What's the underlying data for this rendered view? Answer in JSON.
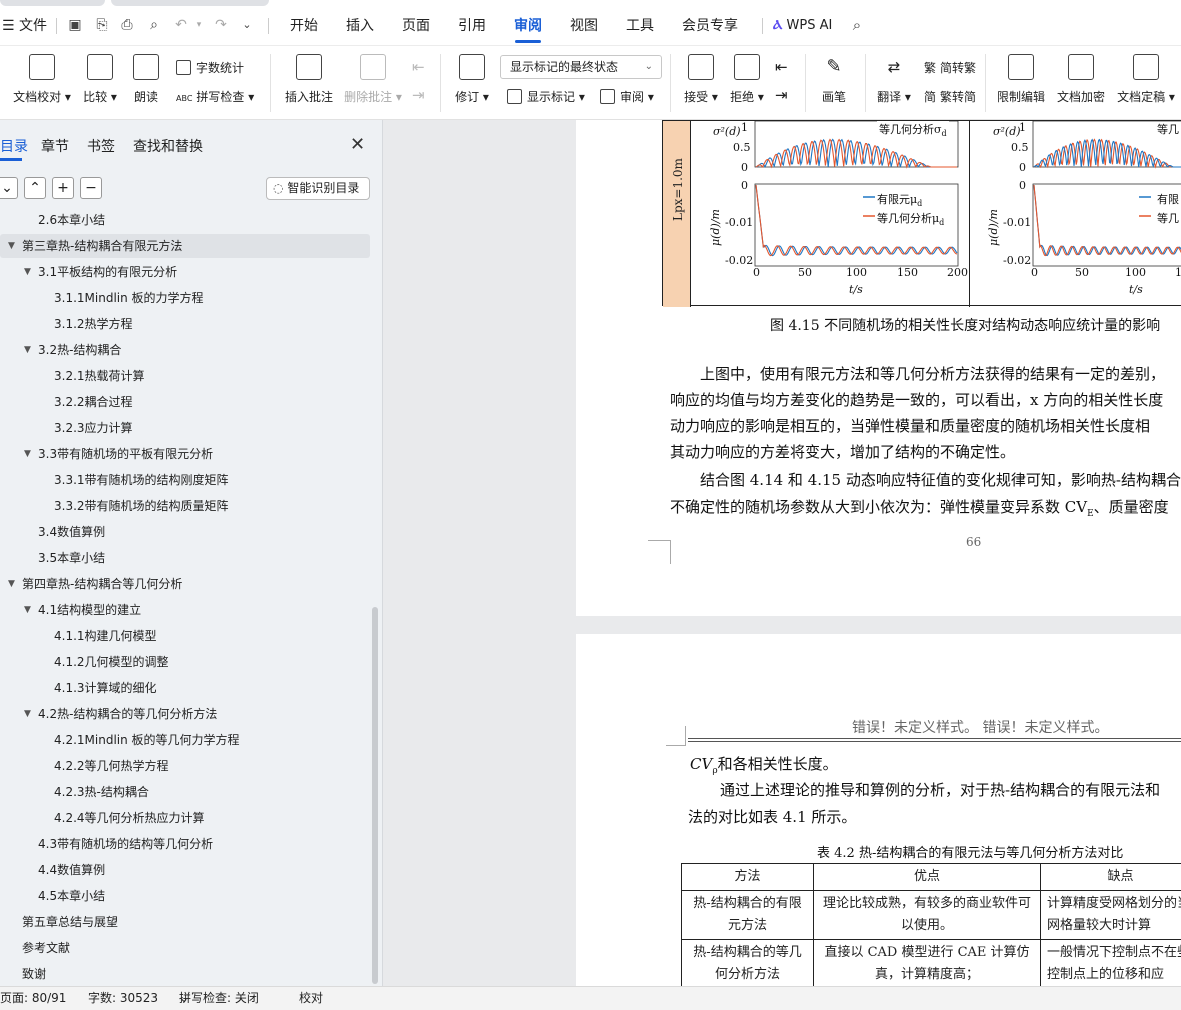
{
  "menubar": {
    "file_label": "文件",
    "items": [
      "开始",
      "插入",
      "页面",
      "引用",
      "审阅",
      "视图",
      "工具",
      "会员专享"
    ],
    "active": "审阅",
    "ai_label": "WPS AI"
  },
  "ribbon": {
    "doc_check": "文档校对",
    "compare": "比较",
    "read_aloud": "朗读",
    "word_count": "字数统计",
    "spell_check": "拼写检查",
    "insert_comment": "插入批注",
    "delete_comment": "删除批注",
    "revise": "修订",
    "markup_state": "显示标记的最终状态",
    "show_markup": "显示标记",
    "review": "审阅",
    "accept": "接受",
    "reject": "拒绝",
    "ink": "画笔",
    "translate": "翻译",
    "trad": "简转繁",
    "simp": "繁转简",
    "restrict_edit": "限制编辑",
    "encrypt": "文档加密",
    "finalize": "文档定稿"
  },
  "sidebar": {
    "tabs": [
      "目录",
      "章节",
      "书签",
      "查找和替换"
    ],
    "smart_toc": "智能识别目录",
    "toc": [
      {
        "text": "2.6本章小结",
        "level": 2,
        "arrow": false
      },
      {
        "text": "第三章热-结构耦合有限元方法",
        "level": 1,
        "arrow": true,
        "selected": true
      },
      {
        "text": "3.1平板结构的有限元分析",
        "level": 2,
        "arrow": true
      },
      {
        "text": "3.1.1Mindlin 板的力学方程",
        "level": 3,
        "arrow": false
      },
      {
        "text": "3.1.2热学方程",
        "level": 3,
        "arrow": false
      },
      {
        "text": "3.2热-结构耦合",
        "level": 2,
        "arrow": true
      },
      {
        "text": "3.2.1热载荷计算",
        "level": 3,
        "arrow": false
      },
      {
        "text": "3.2.2耦合过程",
        "level": 3,
        "arrow": false
      },
      {
        "text": "3.2.3应力计算",
        "level": 3,
        "arrow": false
      },
      {
        "text": "3.3带有随机场的平板有限元分析",
        "level": 2,
        "arrow": true
      },
      {
        "text": "3.3.1带有随机场的结构刚度矩阵",
        "level": 3,
        "arrow": false
      },
      {
        "text": "3.3.2带有随机场的结构质量矩阵",
        "level": 3,
        "arrow": false
      },
      {
        "text": "3.4数值算例",
        "level": 2,
        "arrow": false
      },
      {
        "text": "3.5本章小结",
        "level": 2,
        "arrow": false
      },
      {
        "text": "第四章热-结构耦合等几何分析",
        "level": 1,
        "arrow": true
      },
      {
        "text": "4.1结构模型的建立",
        "level": 2,
        "arrow": true
      },
      {
        "text": "4.1.1构建几何模型",
        "level": 3,
        "arrow": false
      },
      {
        "text": "4.1.2几何模型的调整",
        "level": 3,
        "arrow": false
      },
      {
        "text": "4.1.3计算域的细化",
        "level": 3,
        "arrow": false
      },
      {
        "text": "4.2热-结构耦合的等几何分析方法",
        "level": 2,
        "arrow": true
      },
      {
        "text": "4.2.1Mindlin 板的等几何力学方程",
        "level": 3,
        "arrow": false
      },
      {
        "text": "4.2.2等几何热学方程",
        "level": 3,
        "arrow": false
      },
      {
        "text": "4.2.3热-结构耦合",
        "level": 3,
        "arrow": false
      },
      {
        "text": "4.2.4等几何分析热应力计算",
        "level": 3,
        "arrow": false
      },
      {
        "text": "4.3带有随机场的结构等几何分析",
        "level": 2,
        "arrow": false
      },
      {
        "text": "4.4数值算例",
        "level": 2,
        "arrow": false
      },
      {
        "text": "4.5本章小结",
        "level": 2,
        "arrow": false
      },
      {
        "text": "第五章总结与展望",
        "level": 1,
        "arrow": false
      },
      {
        "text": "参考文献",
        "level": 1,
        "arrow": false
      },
      {
        "text": "致谢",
        "level": 1,
        "arrow": false
      }
    ]
  },
  "doc": {
    "fig_row_label": "Lpx=1.0m",
    "legend_sigma": "等几何分析σ",
    "legend_fem_mu": "有限元μ",
    "legend_iga_mu": "等几何分析μ",
    "legend_right_top": "等几",
    "legend_right_fem": "有限",
    "legend_right_iga": "等几",
    "ylabel_sigma": "σ²(d)",
    "ylabel_mu": "μ(d)/m",
    "xlabel": "t/s",
    "yticks_sigma": [
      "1",
      "0.5",
      "0"
    ],
    "yticks_mu": [
      "0",
      "-0.01",
      "-0.02"
    ],
    "xticks_left": [
      "0",
      "50",
      "100",
      "150",
      "200"
    ],
    "xticks_right": [
      "0",
      "50",
      "100",
      "1"
    ],
    "fig_caption": "图 4.15  不同随机场的相关性长度对结构动态响应统计量的影响",
    "para1": [
      "上图中，使用有限元方法和等几何分析方法获得的结果有一定的差别，",
      "响应的均值与均方差变化的趋势是一致的，可以看出，x 方向的相关性长度",
      "动力响应的影响是相互的，当弹性模量和质量密度的随机场相关性长度相",
      "其动力响应的方差将变大，增加了结构的不确定性。"
    ],
    "para2": [
      "结合图 4.14 和 4.15 动态响应特征值的变化规律可知，影响热-结构耦合",
      "不确定性的随机场参数从大到小依次为：弹性模量变异系数 CV",
      "、质量密度"
    ],
    "page_number": "66",
    "header_error": "错误！未定义样式。 错误！未定义样式。",
    "p2_line1_a": "CV",
    "p2_line1_b": "和各相关性长度。",
    "p2_line2": "通过上述理论的推导和算例的分析，对于热-结构耦合的有限元法和",
    "p2_line3": "法的对比如表 4.1 所示。",
    "table_caption": "表 4.2  热-结构耦合的有限元法与等几何分析方法对比",
    "table": {
      "headers": [
        "方法",
        "优点",
        "缺点"
      ],
      "rows": [
        [
          "热-结构耦合的有限元方法",
          "理论比较成熟，有较多的商业软件可以使用。",
          "计算精度受网格划分的当网格量较大时计算"
        ],
        [
          "热-结构耦合的等几何分析方法",
          "直接以 CAD 模型进行 CAE 计算仿真，计算精度高；",
          "一般情况下控制点不在些控制点上的位移和应"
        ]
      ]
    },
    "sub_E": "E",
    "sub_rho": "ρ",
    "sub_d": "d"
  },
  "status": {
    "page": "页面: 80/91",
    "words": "字数: 30523",
    "spell": "拼写检查: 关闭",
    "proof": "校对"
  },
  "colors": {
    "accent": "#1a5fd6",
    "fem_series": "#1f77c4",
    "iga_series": "#e4572e",
    "fig_label_bg": "#f7d2b1"
  }
}
